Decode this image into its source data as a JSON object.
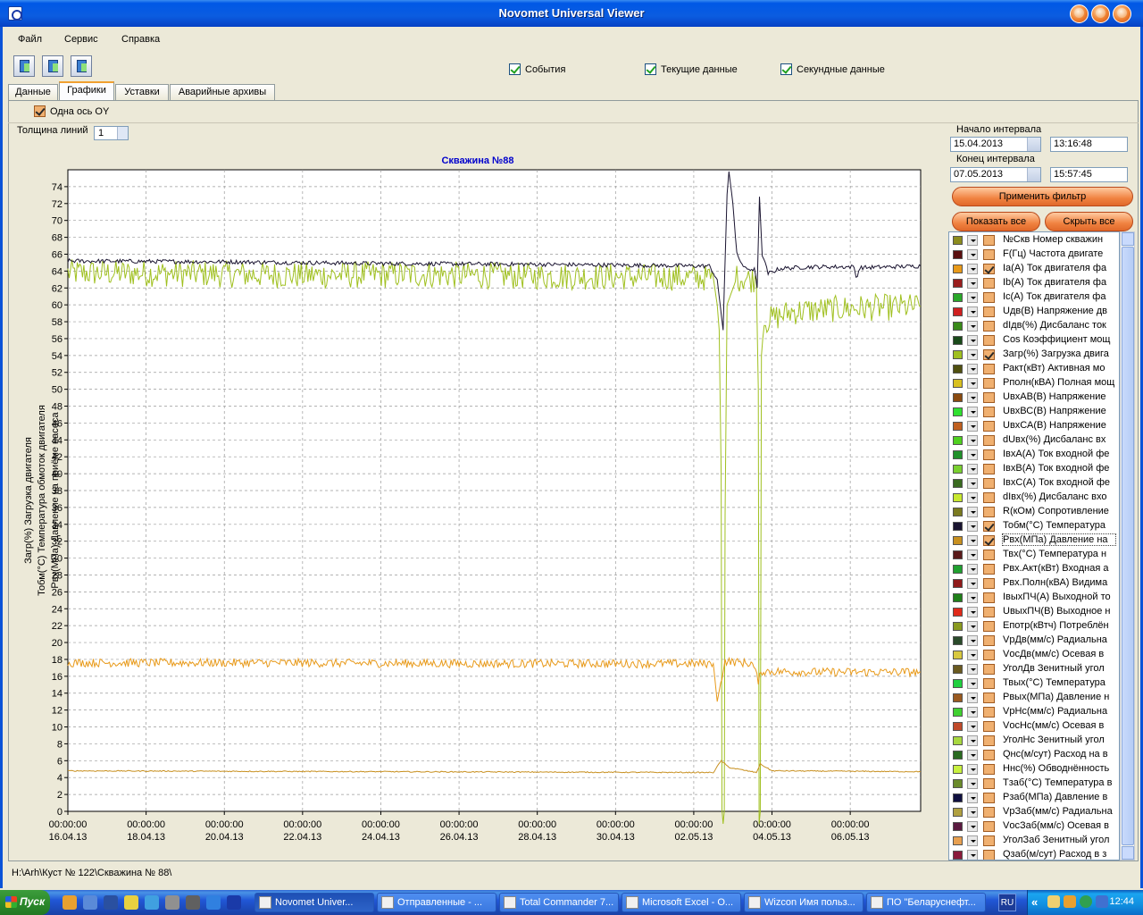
{
  "window": {
    "title": "Novomet Universal Viewer"
  },
  "menu": [
    "Файл",
    "Сервис",
    "Справка"
  ],
  "toolbar": {
    "icons": [
      "open-folder-icon",
      "export-icon",
      "print-icon"
    ]
  },
  "top_checks": [
    {
      "label": "События",
      "checked": true
    },
    {
      "label": "Текущие данные",
      "checked": true
    },
    {
      "label": "Секундные данные",
      "checked": true
    }
  ],
  "tabs": [
    {
      "label": "Данные",
      "active": false
    },
    {
      "label": "Графики",
      "active": true
    },
    {
      "label": "Уставки",
      "active": false
    },
    {
      "label": "Аварийные архивы",
      "active": false
    }
  ],
  "options": {
    "single_axis": {
      "label": "Одна ось OY",
      "checked": true
    },
    "line_width_label": "Толщина линий",
    "line_width_value": "1"
  },
  "interval": {
    "start_label": "Начало интервала",
    "start_date": "15.04.2013",
    "start_time": "13:16:48",
    "end_label": "Конец интервала",
    "end_date": "07.05.2013",
    "end_time": "15:57:45"
  },
  "buttons": {
    "apply_filter": "Применить фильтр",
    "show_all": "Показать все",
    "hide_all": "Скрыть все"
  },
  "parameters": [
    {
      "label": "№Скв Номер скважин",
      "color": "#8c8c1e",
      "checked": false
    },
    {
      "label": "F(Гц) Частота двигате",
      "color": "#5a0f0f",
      "checked": false
    },
    {
      "label": "Ia(A) Ток двигателя фа",
      "color": "#e89a1a",
      "checked": true
    },
    {
      "label": "Ib(A) Ток двигателя фа",
      "color": "#9a1e1e",
      "checked": false
    },
    {
      "label": "Ic(A) Ток двигателя фа",
      "color": "#2aa82a",
      "checked": false
    },
    {
      "label": "Uдв(В) Напряжение дв",
      "color": "#d02020",
      "checked": false
    },
    {
      "label": "dIдв(%) Дисбаланс ток",
      "color": "#3a8a1a",
      "checked": false
    },
    {
      "label": "Cos Коэффициент мощ",
      "color": "#1a4a1a",
      "checked": false
    },
    {
      "label": "Загр(%) Загрузка двига",
      "color": "#a0c020",
      "checked": true
    },
    {
      "label": "Ракт(кВт) Активная мо",
      "color": "#505010",
      "checked": false
    },
    {
      "label": "Рполн(кВА) Полная мощ",
      "color": "#d8c020",
      "checked": false
    },
    {
      "label": "UвхАВ(В) Напряжение",
      "color": "#8a4a10",
      "checked": false
    },
    {
      "label": "UвхВС(В) Напряжение",
      "color": "#30e030",
      "checked": false
    },
    {
      "label": "UвхСА(В) Напряжение",
      "color": "#c06020",
      "checked": false
    },
    {
      "label": "dUвх(%) Дисбаланс вх",
      "color": "#50d020",
      "checked": false
    },
    {
      "label": "IвхА(A) Ток входной фе",
      "color": "#20902a",
      "checked": false
    },
    {
      "label": "IвхВ(A) Ток входной фе",
      "color": "#7ad030",
      "checked": false
    },
    {
      "label": "IвхС(A) Ток входной фе",
      "color": "#3a6a20",
      "checked": false
    },
    {
      "label": "dIвх(%) Дисбаланс вхо",
      "color": "#c8e830",
      "checked": false
    },
    {
      "label": "R(кОм) Сопротивление",
      "color": "#7a7a20",
      "checked": false
    },
    {
      "label": "Тобм(°С) Температура",
      "color": "#1a1430",
      "checked": true
    },
    {
      "label": "Рвх(МПа) Давление на",
      "color": "#c89020",
      "checked": true
    },
    {
      "label": "Твх(°С) Температура н",
      "color": "#5a1a1a",
      "checked": false
    },
    {
      "label": "Рвх.Акт(кВт) Входная а",
      "color": "#20a030",
      "checked": false
    },
    {
      "label": "Рвх.Полн(кВА) Видима",
      "color": "#901a1a",
      "checked": false
    },
    {
      "label": "IвыхПЧ(A) Выходной то",
      "color": "#20801a",
      "checked": false
    },
    {
      "label": "UвыхПЧ(В) Выходное н",
      "color": "#e02a1a",
      "checked": false
    },
    {
      "label": "Епотр(кВтч) Потреблён",
      "color": "#8a9a20",
      "checked": false
    },
    {
      "label": "VрДв(мм/с) Радиальна",
      "color": "#2a4a2a",
      "checked": false
    },
    {
      "label": "VосДв(мм/с) Осевая в",
      "color": "#d8c840",
      "checked": false
    },
    {
      "label": "УголДв Зенитный угол",
      "color": "#6a5a20",
      "checked": false
    },
    {
      "label": "Твых(°С) Температура",
      "color": "#20d040",
      "checked": false
    },
    {
      "label": "Рвых(МПа) Давление н",
      "color": "#9a5a20",
      "checked": false
    },
    {
      "label": "VрНс(мм/с) Радиальна",
      "color": "#40d030",
      "checked": false
    },
    {
      "label": "VосНс(мм/с) Осевая в",
      "color": "#c04a2a",
      "checked": false
    },
    {
      "label": "УголНс Зенитный угол",
      "color": "#a8d840",
      "checked": false
    },
    {
      "label": "Qнс(м/сут) Расход на в",
      "color": "#2a6a20",
      "checked": false
    },
    {
      "label": "Ннс(%) Обводнённость",
      "color": "#c8f040",
      "checked": false
    },
    {
      "label": "Тзаб(°С) Температура в",
      "color": "#6a8a2a",
      "checked": false
    },
    {
      "label": "Рзаб(МПа) Давление в",
      "color": "#101040",
      "checked": false
    },
    {
      "label": "VрЗаб(мм/с) Радиальна",
      "color": "#b0a040",
      "checked": false
    },
    {
      "label": "VосЗаб(мм/с) Осевая в",
      "color": "#5a1a40",
      "checked": false
    },
    {
      "label": "УголЗаб Зенитный угол",
      "color": "#e8a050",
      "checked": false
    },
    {
      "label": "Qзаб(м/сут) Расход в з",
      "color": "#8a1a3a",
      "checked": false
    }
  ],
  "status": {
    "path": "H:\\Arh\\Куст № 122\\Скважина № 88\\"
  },
  "taskbar": {
    "start": "Пуск",
    "buttons": [
      {
        "label": "Novomet Univer...",
        "active": true
      },
      {
        "label": "Отправленные - ...",
        "active": false
      },
      {
        "label": "Total Commander 7...",
        "active": false
      },
      {
        "label": "Microsoft Excel - О...",
        "active": false
      },
      {
        "label": "Wizcon Имя польз...",
        "active": false
      },
      {
        "label": "ПО \"Беларуснефт...",
        "active": false
      }
    ],
    "lang": "RU",
    "clock": "12:44"
  },
  "chart_data": {
    "type": "line",
    "title": "Скважина №88",
    "ylabel_lines": [
      "Загр(%) Загрузка двигателя",
      "Тобм(°С) Температура обмоток двигателя",
      "Рвх(МПа) Давление на приёме насоса"
    ],
    "ylim": [
      0,
      76
    ],
    "yticks": [
      0,
      2,
      4,
      6,
      8,
      10,
      12,
      14,
      16,
      18,
      20,
      22,
      24,
      26,
      28,
      30,
      32,
      34,
      36,
      38,
      40,
      42,
      44,
      46,
      48,
      50,
      52,
      54,
      56,
      58,
      60,
      62,
      64,
      66,
      68,
      70,
      72,
      74
    ],
    "xlim_days": [
      0,
      21.8
    ],
    "x_ticks": [
      {
        "day": 0,
        "time": "00:00:00",
        "date": "16.04.13"
      },
      {
        "day": 2,
        "time": "00:00:00",
        "date": "18.04.13"
      },
      {
        "day": 4,
        "time": "00:00:00",
        "date": "20.04.13"
      },
      {
        "day": 6,
        "time": "00:00:00",
        "date": "22.04.13"
      },
      {
        "day": 8,
        "time": "00:00:00",
        "date": "24.04.13"
      },
      {
        "day": 10,
        "time": "00:00:00",
        "date": "26.04.13"
      },
      {
        "day": 12,
        "time": "00:00:00",
        "date": "28.04.13"
      },
      {
        "day": 14,
        "time": "00:00:00",
        "date": "30.04.13"
      },
      {
        "day": 16,
        "time": "00:00:00",
        "date": "02.05.13"
      },
      {
        "day": 18,
        "time": "00:00:00",
        "date": "04.05.13"
      },
      {
        "day": 20,
        "time": "00:00:00",
        "date": "06.05.13"
      }
    ],
    "grid": true,
    "series": [
      {
        "name": "Загр(%) Загрузка двигателя",
        "color": "#a0c020",
        "noise": 1.6,
        "points": [
          [
            0,
            63.8
          ],
          [
            3,
            63.7
          ],
          [
            6,
            63.5
          ],
          [
            9,
            63.6
          ],
          [
            12,
            63.4
          ],
          [
            15,
            63.3
          ],
          [
            16.5,
            63.2
          ],
          [
            16.6,
            60
          ],
          [
            16.65,
            57
          ],
          [
            16.7,
            40
          ],
          [
            16.72,
            0
          ],
          [
            16.78,
            0
          ],
          [
            16.8,
            35
          ],
          [
            16.85,
            60
          ],
          [
            17.1,
            63.2
          ],
          [
            17.6,
            63.0
          ],
          [
            17.65,
            50
          ],
          [
            17.67,
            0
          ],
          [
            17.7,
            0
          ],
          [
            17.73,
            54
          ],
          [
            17.8,
            58
          ],
          [
            18.5,
            59.2
          ],
          [
            20,
            59.6
          ],
          [
            21.8,
            59.8
          ]
        ]
      },
      {
        "name": "Тобм(°С) Температура обмоток двигателя",
        "color": "#1a1430",
        "noise": 0.25,
        "points": [
          [
            0,
            65.2
          ],
          [
            4,
            65.1
          ],
          [
            8,
            64.9
          ],
          [
            12,
            64.8
          ],
          [
            16.4,
            64.6
          ],
          [
            16.6,
            63
          ],
          [
            16.75,
            57
          ],
          [
            16.85,
            73
          ],
          [
            16.9,
            75.8
          ],
          [
            17.0,
            72
          ],
          [
            17.1,
            66
          ],
          [
            17.3,
            64.3
          ],
          [
            17.55,
            64.2
          ],
          [
            17.62,
            62
          ],
          [
            17.68,
            72.8
          ],
          [
            17.75,
            66
          ],
          [
            17.9,
            63.7
          ],
          [
            18.2,
            64.3
          ],
          [
            19,
            64.5
          ],
          [
            20.1,
            64.5
          ],
          [
            20.15,
            63.2
          ],
          [
            20.25,
            64.4
          ],
          [
            21.8,
            64.6
          ]
        ]
      },
      {
        "name": "Ia(A) Ток двигателя фазы A",
        "color": "#e89a1a",
        "noise": 0.5,
        "points": [
          [
            0,
            17.6
          ],
          [
            5,
            17.6
          ],
          [
            10,
            17.5
          ],
          [
            16.5,
            17.5
          ],
          [
            16.6,
            13
          ],
          [
            16.72,
            16
          ],
          [
            16.8,
            17.8
          ],
          [
            17.5,
            17.5
          ],
          [
            17.65,
            15.5
          ],
          [
            17.75,
            16.6
          ],
          [
            19,
            16.5
          ],
          [
            21.8,
            16.5
          ]
        ]
      },
      {
        "name": "Рвх(МПа) Давление на приёме насоса",
        "color": "#c89020",
        "noise": 0.06,
        "points": [
          [
            0,
            4.8
          ],
          [
            8,
            4.7
          ],
          [
            16.5,
            4.6
          ],
          [
            16.7,
            6.0
          ],
          [
            16.9,
            5.2
          ],
          [
            17.6,
            4.6
          ],
          [
            17.7,
            5.6
          ],
          [
            18,
            4.8
          ],
          [
            21.8,
            4.7
          ]
        ]
      }
    ]
  }
}
